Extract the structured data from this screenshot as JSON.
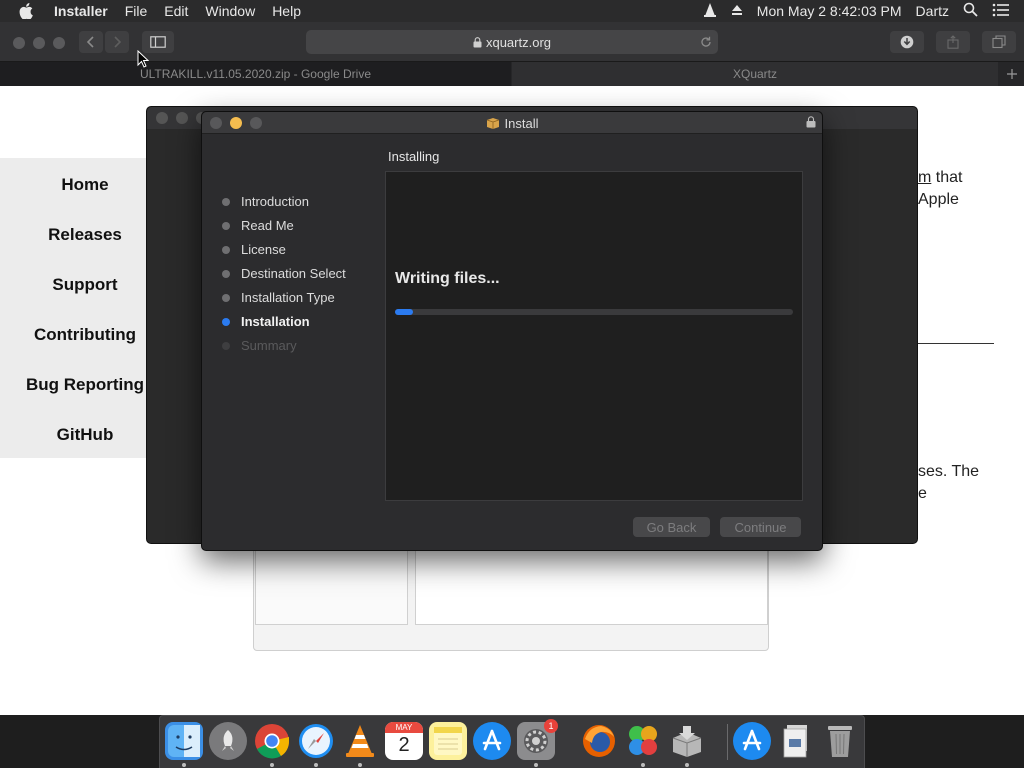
{
  "menubar": {
    "app": "Installer",
    "items": [
      "File",
      "Edit",
      "Window",
      "Help"
    ],
    "clock": "Mon May 2  8:42:03 PM",
    "user": "Dartz"
  },
  "browser": {
    "url": "xquartz.org",
    "tabs": [
      "ULTRAKILL.v11.05.2020.zip - Google Drive",
      "XQuartz"
    ]
  },
  "site": {
    "nav": [
      "Home",
      "Releases",
      "Support",
      "Contributing",
      "Bug Reporting",
      "GitHub"
    ],
    "text_fragments": {
      "a": "m",
      "b": " that",
      "c": "Apple",
      "d": "ses. The",
      "e": "e"
    }
  },
  "installer": {
    "title": "Install",
    "section_heading": "Installing",
    "steps": [
      "Introduction",
      "Read Me",
      "License",
      "Destination Select",
      "Installation Type",
      "Installation",
      "Summary"
    ],
    "active_step": "Installation",
    "status": "Writing files...",
    "progress": 0.045,
    "back_label": "Go Back",
    "continue_label": "Continue"
  },
  "dock": {
    "apps": [
      "Finder",
      "Launchpad",
      "Chrome",
      "Safari",
      "VLC",
      "Calendar",
      "Notes",
      "App Store",
      "System Preferences",
      "Firefox",
      "Game",
      "Installer",
      "App Store",
      "Files",
      "Trash"
    ],
    "calendar": {
      "month": "MAY",
      "day": "2"
    },
    "badge": "1"
  }
}
